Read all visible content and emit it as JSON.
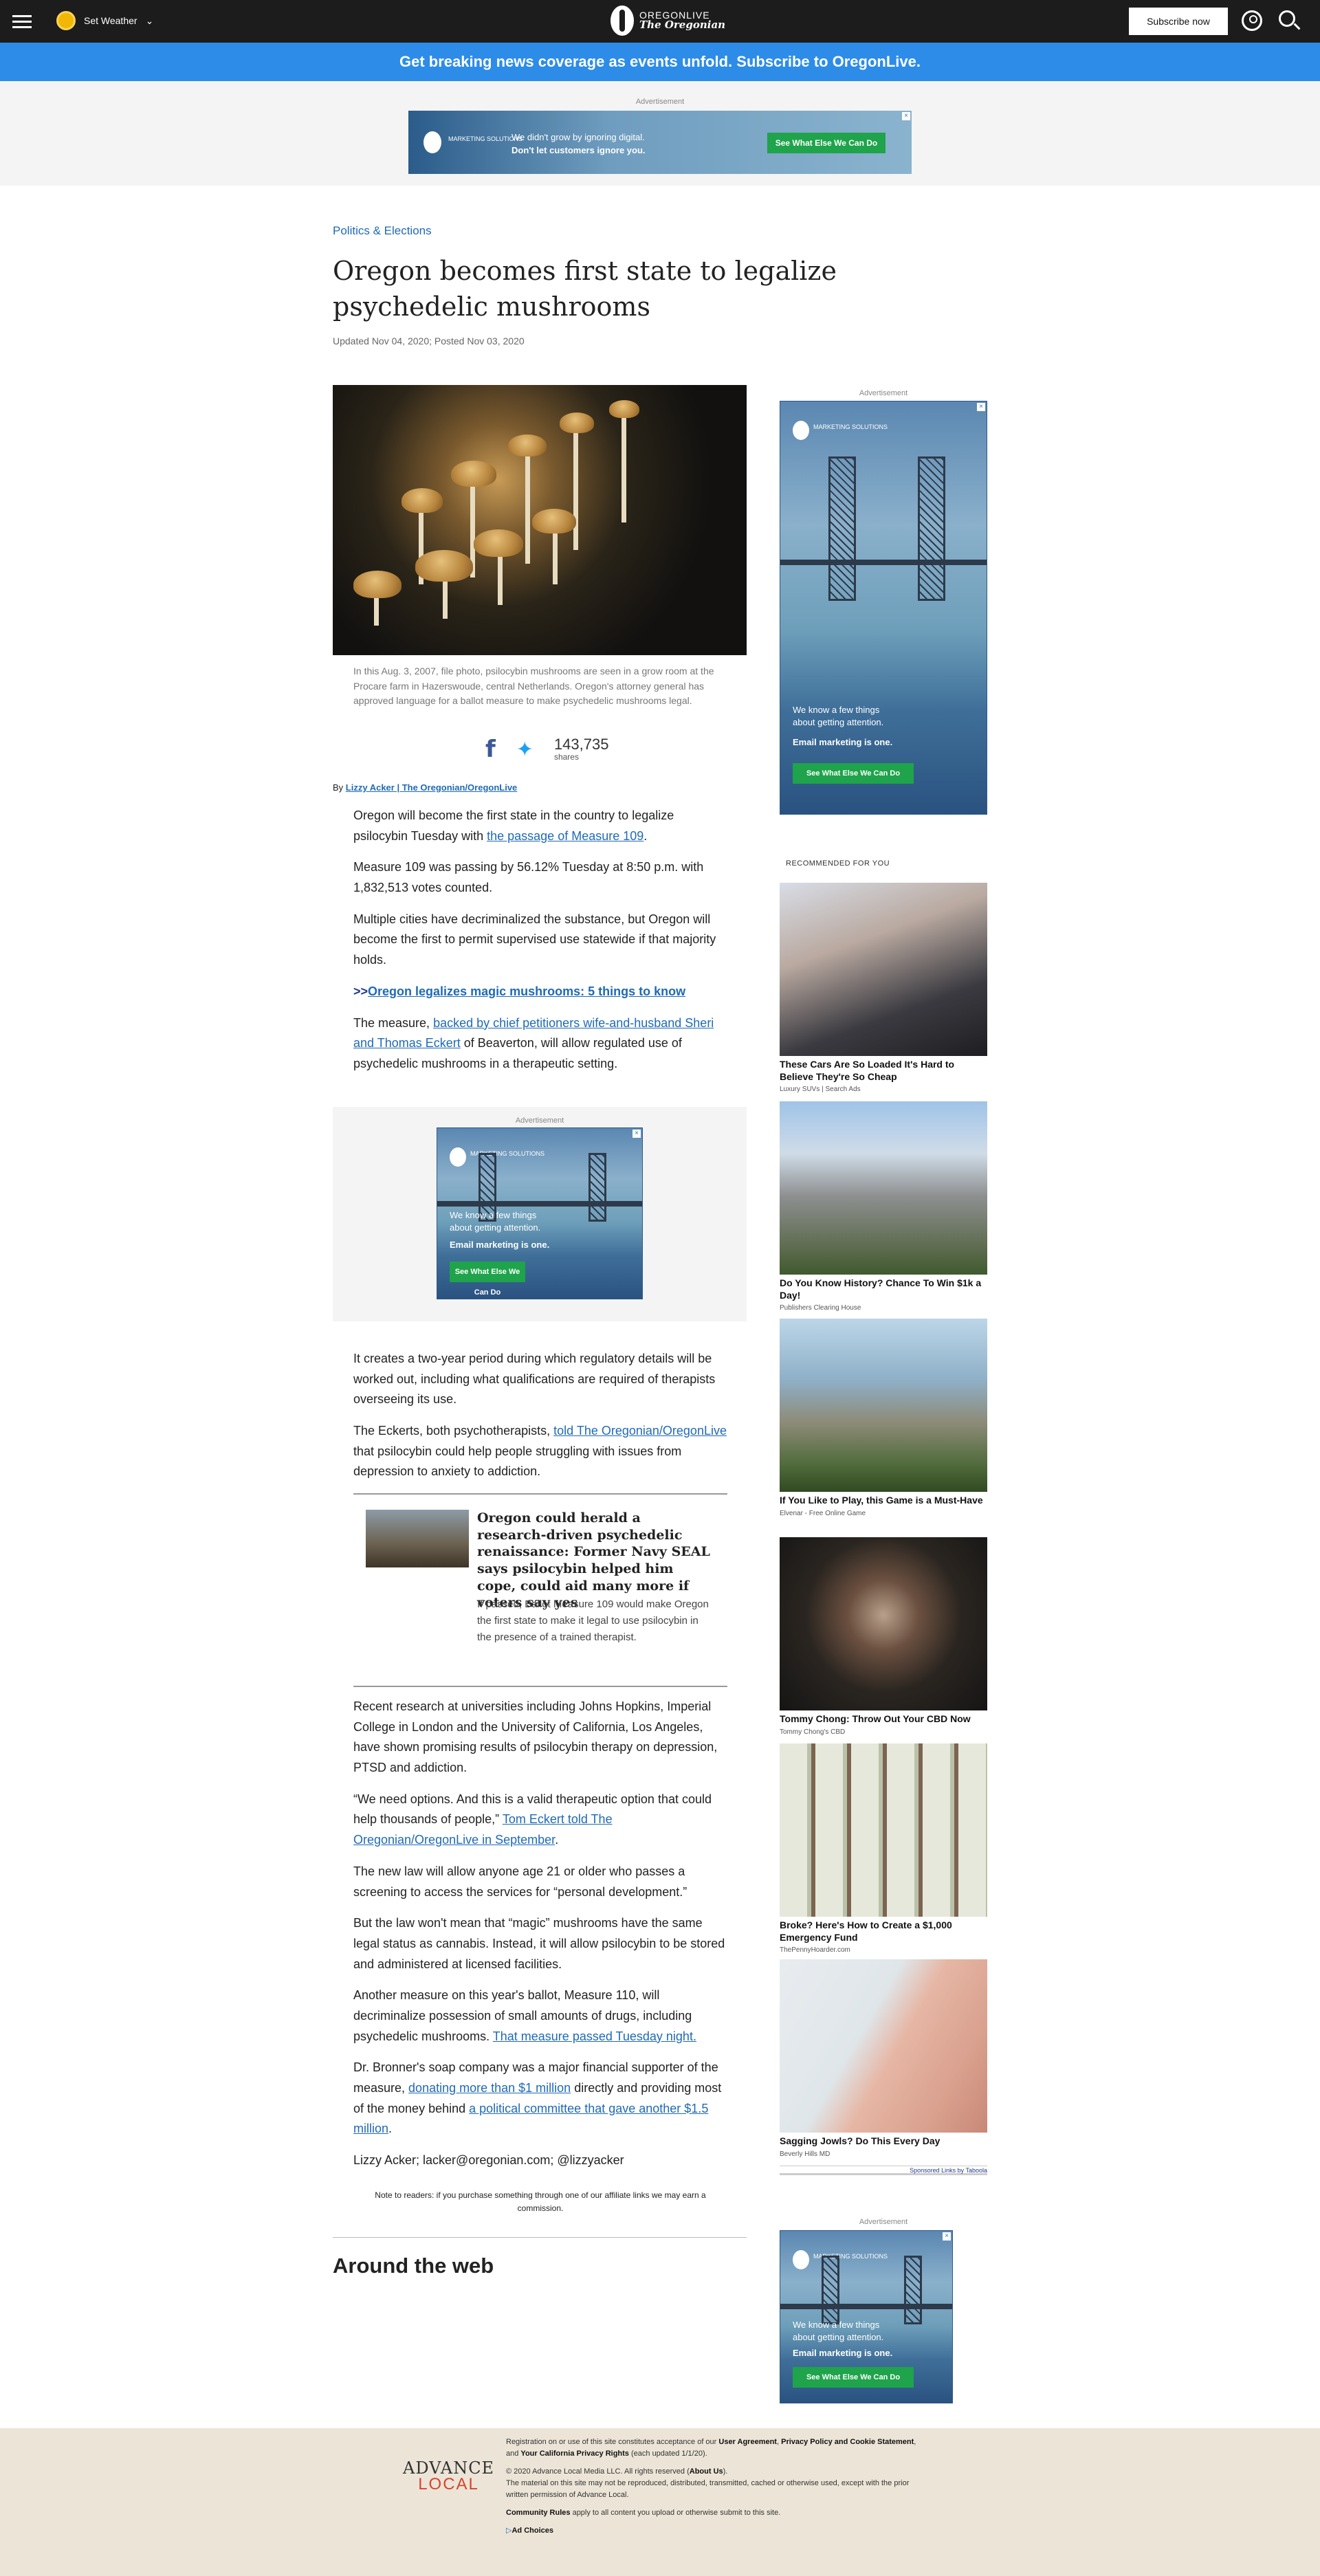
{
  "topbar": {
    "weather_label": "Set Weather",
    "logo_top": "OREGONLIVE",
    "logo_bottom": "The Oregonian",
    "subscribe_label": "Subscribe now"
  },
  "promo_banner": "Get breaking news coverage as events unfold. Subscribe to OregonLive.",
  "top_ad": {
    "label": "Advertisement",
    "brand": "MARKETING SOLUTIONS",
    "line1": "We didn't grow by ignoring digital.",
    "line2": "Don't let customers ignore you.",
    "cta": "See What Else We Can Do"
  },
  "article": {
    "kicker": "Politics & Elections",
    "headline": "Oregon becomes first state to legalize psychedelic mushrooms",
    "dateline": "Updated Nov 04, 2020; Posted Nov 03, 2020",
    "caption": "In this Aug. 3, 2007, file photo, psilocybin mushrooms are seen in a grow room at the Procare farm in Hazerswoude, central Netherlands. Oregon's attorney general has approved language for a ballot measure to make psychedelic mushrooms legal.",
    "share_count": "143,735",
    "share_label": "shares",
    "byline_prefix": "By",
    "byline_author": "Lizzy Acker | The Oregonian/OregonLive",
    "p1_a": "Oregon will become the first state in the country to legalize psilocybin Tuesday with ",
    "p1_link": "the passage of Measure 109",
    "p1_b": ".",
    "p2": "Measure 109 was passing by 56.12% Tuesday at 8:50 p.m. with 1,832,513 votes counted.",
    "p3": "Multiple cities have decriminalized the substance, but Oregon will become the first to permit supervised use statewide if that majority holds.",
    "p4_prefix": ">>",
    "p4_link": "Oregon legalizes magic mushrooms: 5 things to know",
    "p5_a": "The measure, ",
    "p5_link": "backed by chief petitioners wife-and-husband Sheri and Thomas Eckert",
    "p5_b": " of Beaverton, will allow regulated use of psychedelic mushrooms in a therapeutic setting.",
    "p6": "It creates a two-year period during which regulatory details will be worked out, including what qualifications are required of therapists overseeing its use.",
    "p7_a": "The Eckerts, both psychotherapists, ",
    "p7_link": "told The Oregonian/OregonLive",
    "p7_b": " that psilocybin could help people struggling with issues from depression to anxiety to addiction.",
    "related_title": "Oregon could herald a research-driven psychedelic renaissance: Former Navy SEAL says psilocybin helped him cope, could aid many more if voters say yes",
    "related_desc": "If passed, Ballot Measure 109 would make Oregon the first state to make it legal to use psilocybin in the presence of a trained therapist.",
    "p8": "Recent research at universities including Johns Hopkins, Imperial College in London and the University of California, Los Angeles, have shown promising results of psilocybin therapy on depression, PTSD and addiction.",
    "p9_a": "“We need options. And this is a valid therapeutic option that could help thousands of people,” ",
    "p9_link": "Tom Eckert told The Oregonian/OregonLive in September",
    "p9_b": ".",
    "p10": "The new law will allow anyone age 21 or older who passes a screening to access the services for “personal development.”",
    "p11": "But the law won't mean that “magic” mushrooms have the same legal status as cannabis. Instead, it will allow psilocybin to be stored and administered at licensed facilities.",
    "p12_a": "Another measure on this year's ballot, Measure 110, will decriminalize possession of small amounts of drugs, including psychedelic mushrooms. ",
    "p12_link": "That measure passed Tuesday night.",
    "p13_a": "Dr. Bronner's soap company was a major financial supporter of the measure, ",
    "p13_link1": "donating more than $1 million",
    "p13_b": " directly and providing most of the money behind ",
    "p13_link2": "a political committee that gave another $1.5 million",
    "p13_c": ".",
    "signoff": "Lizzy Acker; lacker@oregonian.com; @lizzyacker",
    "disclaimer": "Note to readers: if you purchase something through one of our affiliate links we may earn a commission.",
    "around_web": "Around the web"
  },
  "ads": {
    "label": "Advertisement",
    "brand": "MARKETING SOLUTIONS",
    "line1": "We know a few things",
    "line2": "about getting attention.",
    "bold": "Email marketing is one.",
    "cta": "See What Else We Can Do"
  },
  "recommended": {
    "heading": "RECOMMENDED FOR YOU",
    "items": [
      {
        "title": "These Cars Are So Loaded It's Hard to Believe They're So Cheap",
        "source": "Luxury SUVs | Search Ads"
      },
      {
        "title": "Do You Know History? Chance To Win $1k a Day!",
        "source": "Publishers Clearing House"
      },
      {
        "title": "If You Like to Play, this Game is a Must-Have",
        "source": "Elvenar - Free Online Game"
      },
      {
        "title": "Tommy Chong: Throw Out Your CBD Now",
        "source": "Tommy Chong's CBD"
      },
      {
        "title": "Broke? Here's How to Create a $1,000 Emergency Fund",
        "source": "ThePennyHoarder.com"
      },
      {
        "title": "Sagging Jowls? Do This Every Day",
        "source": "Beverly Hills MD"
      }
    ],
    "sponsored": "Sponsored Links by Taboola"
  },
  "footer": {
    "logo_top": "ADVANCE",
    "logo_bottom": "LOCAL",
    "line1_a": "Registration on or use of this site constitutes acceptance of our ",
    "user_agreement": "User Agreement",
    "sep1": ", ",
    "privacy": "Privacy Policy and Cookie Statement",
    "sep2": ", and ",
    "ca_rights": "Your California Privacy Rights",
    "line1_b": " (each updated 1/1/20).",
    "copyright_a": "© 2020 Advance Local Media LLC. All rights reserved (",
    "about": "About Us",
    "copyright_b": ").",
    "material": "The material on this site may not be reproduced, distributed, transmitted, cached or otherwise used, except with the prior written permission of Advance Local.",
    "community": "Community Rules",
    "community_b": " apply to all content you upload or otherwise submit to this site.",
    "ad_choices": "Ad Choices"
  },
  "colors": {
    "topbar": "#1c1c1c",
    "promo": "#2d8ce8",
    "link": "#1f6ab5",
    "cta": "#1fa34b",
    "footer": "#ece5d7"
  }
}
